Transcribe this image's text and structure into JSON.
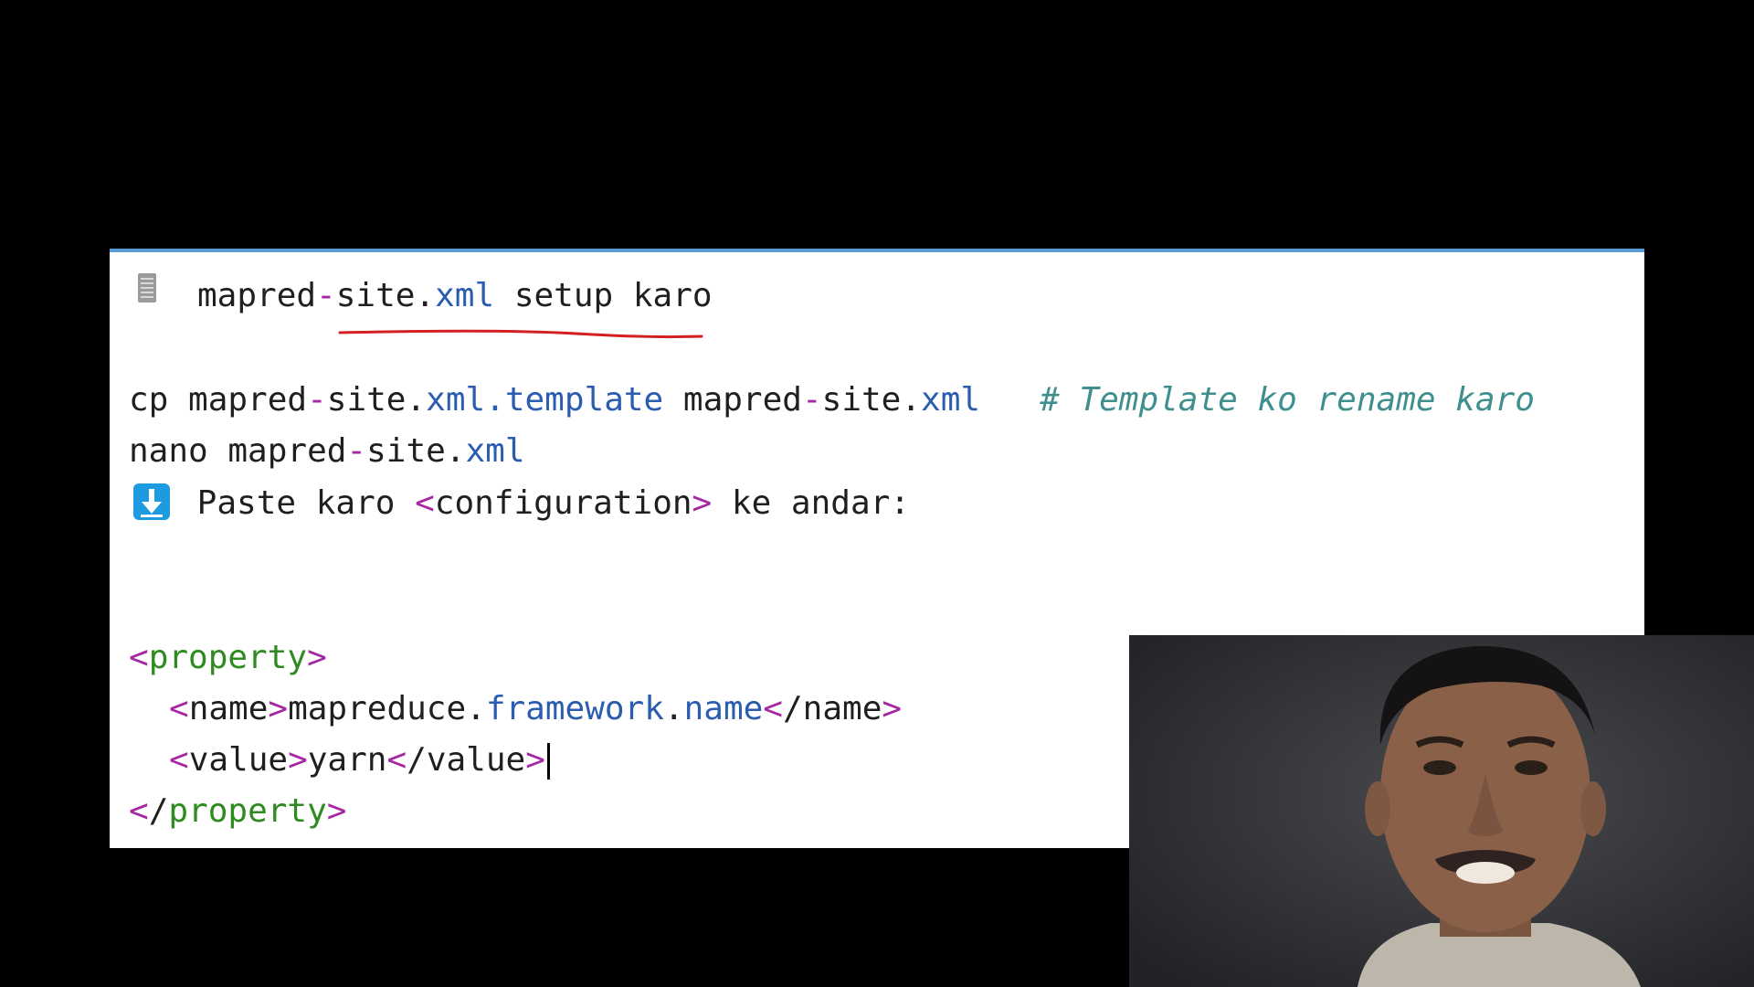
{
  "title": {
    "icon": "document-icon",
    "filename_part1": "mapred",
    "filename_dash": "-",
    "filename_part2": "site.",
    "filename_ext": "xml",
    "suffix": " setup karo"
  },
  "commands": {
    "cp_line": {
      "cmd": "cp mapred",
      "dash1": "-",
      "mid1": "site.",
      "ext1": "xml.template",
      "space": " mapred",
      "dash2": "-",
      "mid2": "site.",
      "ext2": "xml",
      "comment": "   # Template ko rename karo"
    },
    "nano_line": {
      "cmd": "nano mapred",
      "dash": "-",
      "mid": "site.",
      "ext": "xml"
    }
  },
  "instruction": {
    "icon": "down-arrow-icon",
    "text_before": " Paste karo ",
    "open_bracket": "<",
    "tag": "configuration",
    "close_bracket": ">",
    "text_after": " ke andar:"
  },
  "xml_snippet": {
    "property_open": "property",
    "name_tag": "name",
    "name_value_part1": "mapreduce.",
    "name_value_part2": "framework",
    "name_value_part3": ".",
    "name_value_part4": "name",
    "value_tag": "value",
    "value_text": "yarn",
    "property_close": "property"
  },
  "colors": {
    "panel_border": "#5b9bd5",
    "dash": "#a626a4",
    "extension": "#2a5db0",
    "comment": "#3f8f8f",
    "xml_tag": "#2e8b1f",
    "underline_mark": "#d21f1f"
  }
}
